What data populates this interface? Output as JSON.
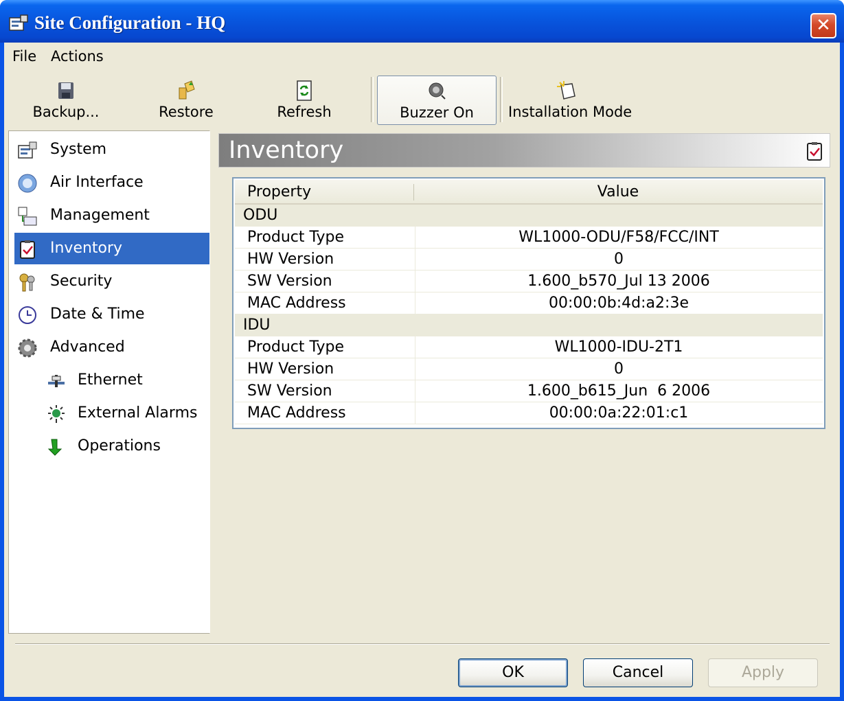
{
  "window": {
    "title": "Site Configuration - HQ",
    "close_symbol": "✕"
  },
  "menu": {
    "file": "File",
    "actions": "Actions"
  },
  "toolbar": {
    "backup": "Backup...",
    "restore": "Restore",
    "refresh": "Refresh",
    "buzzer": "Buzzer On",
    "installation": "Installation Mode"
  },
  "nav": {
    "items": [
      {
        "label": "System",
        "icon": "system-icon"
      },
      {
        "label": "Air Interface",
        "icon": "air-interface-icon"
      },
      {
        "label": "Management",
        "icon": "management-icon"
      },
      {
        "label": "Inventory",
        "icon": "inventory-icon"
      },
      {
        "label": "Security",
        "icon": "security-keys-icon"
      },
      {
        "label": "Date & Time",
        "icon": "clock-icon"
      },
      {
        "label": "Advanced",
        "icon": "gear-icon"
      },
      {
        "label": "Ethernet",
        "icon": "ethernet-icon"
      },
      {
        "label": "External Alarms",
        "icon": "alarm-icon"
      },
      {
        "label": "Operations",
        "icon": "green-arrow-icon"
      }
    ],
    "selected": "Inventory"
  },
  "panel": {
    "title": "Inventory"
  },
  "table": {
    "col_property": "Property",
    "col_value": "Value",
    "groups": [
      {
        "name": "ODU",
        "rows": [
          {
            "property": "Product Type",
            "value": "WL1000-ODU/F58/FCC/INT"
          },
          {
            "property": "HW Version",
            "value": "0"
          },
          {
            "property": "SW Version",
            "value": "1.600_b570_Jul 13 2006"
          },
          {
            "property": "MAC Address",
            "value": "00:00:0b:4d:a2:3e"
          }
        ]
      },
      {
        "name": "IDU",
        "rows": [
          {
            "property": "Product Type",
            "value": "WL1000-IDU-2T1"
          },
          {
            "property": "HW Version",
            "value": "0"
          },
          {
            "property": "SW Version",
            "value": "1.600_b615_Jun  6 2006"
          },
          {
            "property": "MAC Address",
            "value": "00:00:0a:22:01:c1"
          }
        ]
      }
    ]
  },
  "buttons": {
    "ok": "OK",
    "cancel": "Cancel",
    "apply": "Apply"
  }
}
